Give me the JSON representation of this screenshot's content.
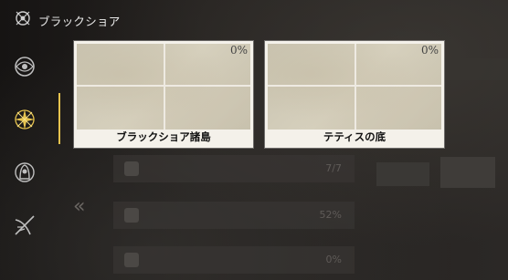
{
  "header": {
    "title": "ブラックショア"
  },
  "sidebar": {
    "items": [
      {
        "icon": "shell-spiral-icon"
      },
      {
        "icon": "star-burst-icon",
        "active": true
      },
      {
        "icon": "hooded-figure-icon"
      },
      {
        "icon": "crossed-blades-icon"
      }
    ]
  },
  "cards": [
    {
      "name": "ブラックショア諸島",
      "percent": "0%"
    },
    {
      "name": "テティスの底",
      "percent": "0%"
    }
  ],
  "background": {
    "back_icon": "«",
    "rows": [
      {
        "value": "7/7"
      },
      {
        "value": "52%"
      },
      {
        "value": "0%"
      }
    ]
  },
  "colors": {
    "accent": "#e6c34e",
    "card_bg": "#f4f1ea"
  }
}
